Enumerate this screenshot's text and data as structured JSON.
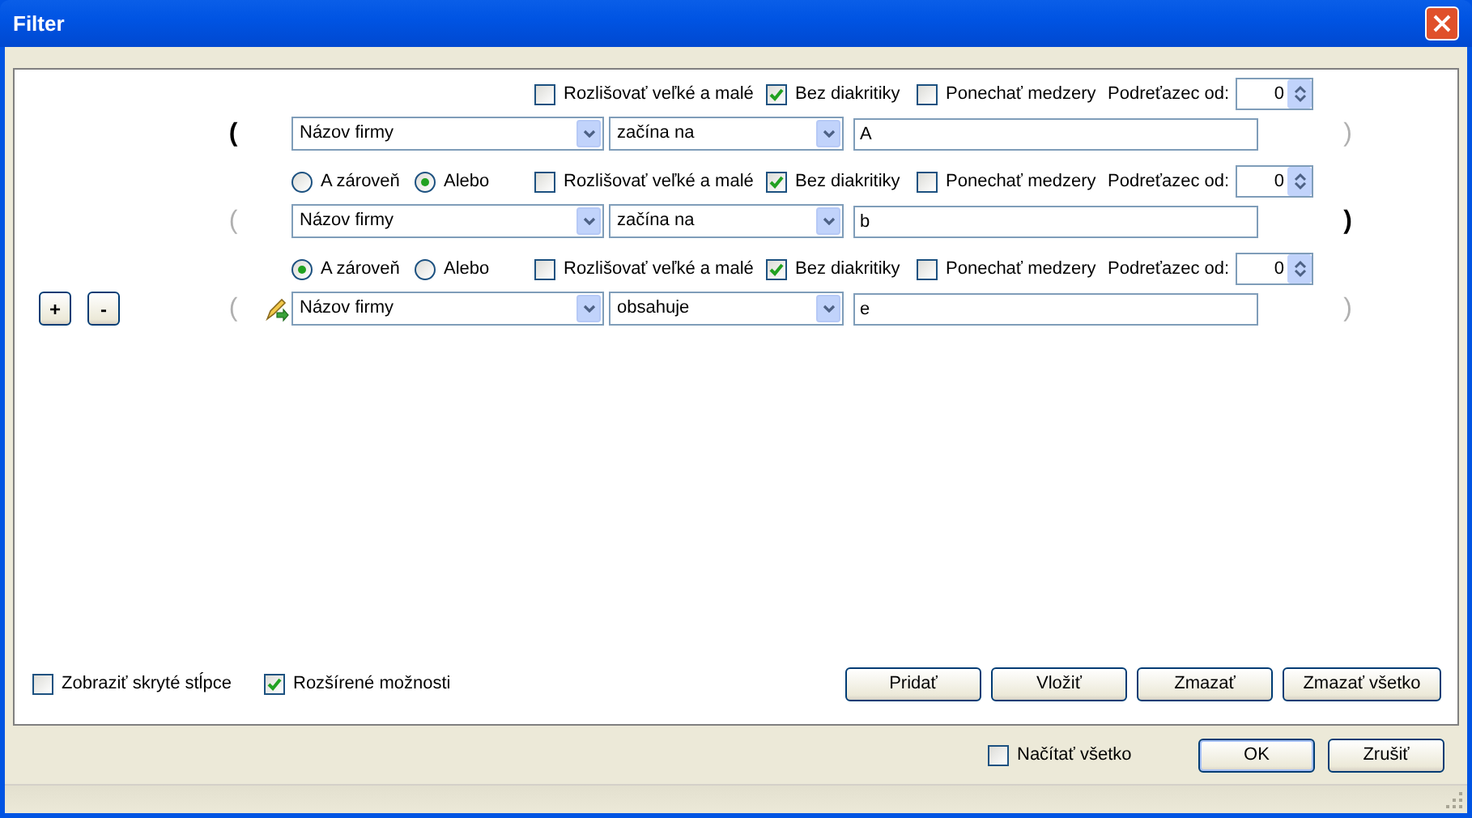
{
  "window": {
    "title": "Filter"
  },
  "row_buttons": [
    "+",
    "-"
  ],
  "conditions": [
    {
      "open_paren": {
        "text": "(",
        "active": true
      },
      "close_paren": {
        "text": ")",
        "active": false
      },
      "editing": false,
      "checkboxes": [
        {
          "label": "Rozlišovať veľké a malé",
          "checked": false
        },
        {
          "label": "Bez diakritiky",
          "checked": true
        },
        {
          "label": "Ponechať medzery",
          "checked": false
        }
      ],
      "substring": {
        "label": "Podreťazec od:",
        "value": "0"
      },
      "column": "Názov firmy",
      "operator": "začína na",
      "value": "A"
    },
    {
      "connector": [
        {
          "label": "A zároveň",
          "selected": false
        },
        {
          "label": "Alebo",
          "selected": true
        }
      ],
      "open_paren": {
        "text": "(",
        "active": false
      },
      "close_paren": {
        "text": ")",
        "active": true
      },
      "editing": false,
      "checkboxes": [
        {
          "label": "Rozlišovať veľké a malé",
          "checked": false
        },
        {
          "label": "Bez diakritiky",
          "checked": true
        },
        {
          "label": "Ponechať medzery",
          "checked": false
        }
      ],
      "substring": {
        "label": "Podreťazec od:",
        "value": "0"
      },
      "column": "Názov firmy",
      "operator": "začína na",
      "value": "b"
    },
    {
      "connector": [
        {
          "label": "A zároveň",
          "selected": true
        },
        {
          "label": "Alebo",
          "selected": false
        }
      ],
      "open_paren": {
        "text": "(",
        "active": false
      },
      "close_paren": {
        "text": ")",
        "active": false
      },
      "editing": true,
      "checkboxes": [
        {
          "label": "Rozlišovať veľké a malé",
          "checked": false
        },
        {
          "label": "Bez diakritiky",
          "checked": true
        },
        {
          "label": "Ponechať medzery",
          "checked": false
        }
      ],
      "substring": {
        "label": "Podreťazec od:",
        "value": "0"
      },
      "column": "Názov firmy",
      "operator": "obsahuje",
      "value": "e"
    }
  ],
  "panel_options": [
    {
      "label": "Zobraziť skryté stĺpce",
      "checked": false
    },
    {
      "label": "Rozšírené možnosti",
      "checked": true
    }
  ],
  "panel_buttons": [
    "Pridať",
    "Vložiť",
    "Zmazať",
    "Zmazať všetko"
  ],
  "load_all": {
    "label": "Načítať všetko",
    "checked": false
  },
  "dialog_buttons": [
    "OK",
    "Zrušiť"
  ]
}
